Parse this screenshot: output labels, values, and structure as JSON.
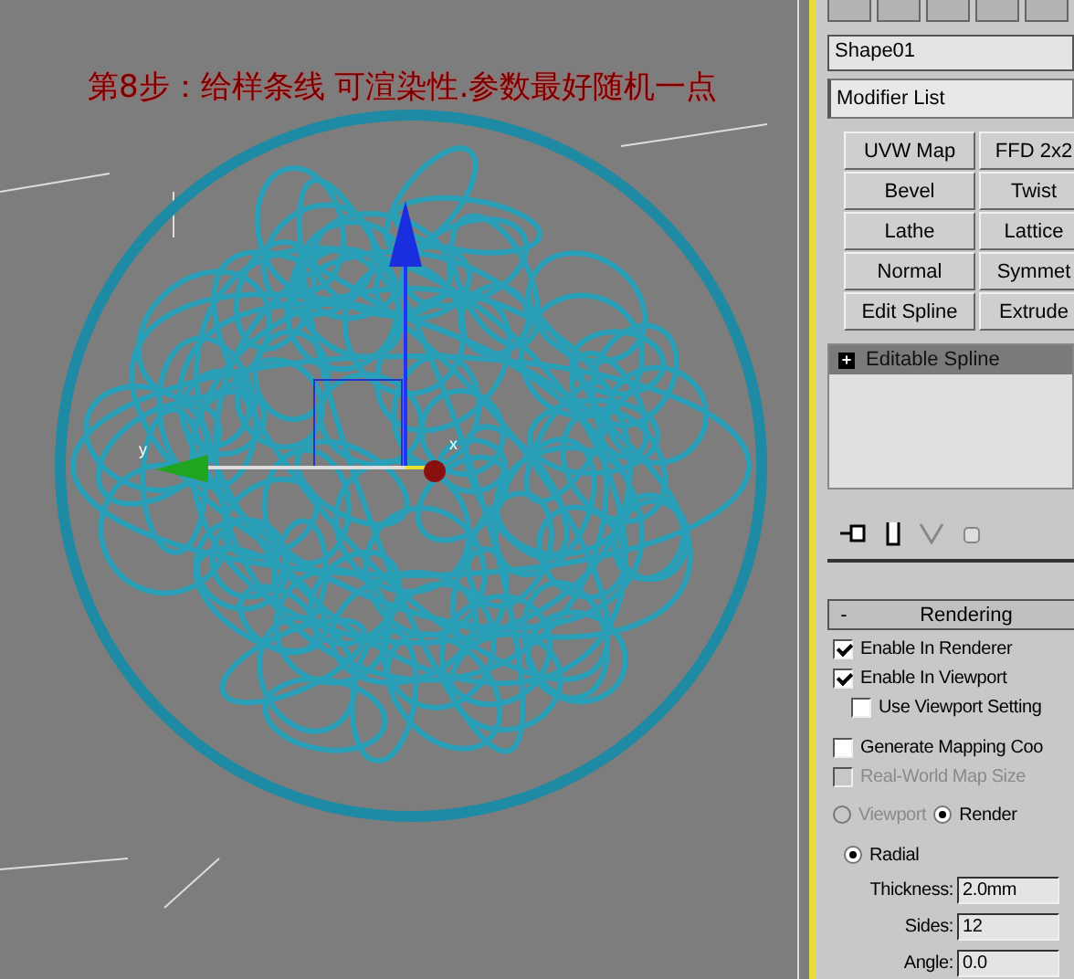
{
  "caption": "第8步：给样条线 可渲染性.参数最好随机一点",
  "viewport": {
    "axis_labels": [
      "y",
      "x"
    ]
  },
  "object_name": "Shape01",
  "modifier_list": "Modifier List",
  "modifier_buttons": [
    "UVW Map",
    "FFD 2x2",
    "Bevel",
    "Twist",
    "Lathe",
    "Lattice",
    "Normal",
    "Symmet",
    "Edit Spline",
    "Extrude"
  ],
  "stack": [
    {
      "label": "Editable Spline",
      "toggle": "+",
      "selected": true
    }
  ],
  "rollout": {
    "toggle": "-",
    "title": "Rendering"
  },
  "options": [
    {
      "label": "Enable In Renderer",
      "checked": true,
      "disabled": false
    },
    {
      "label": "Enable In Viewport",
      "checked": true,
      "disabled": false,
      "children": [
        {
          "label": "Use Viewport Setting",
          "checked": false,
          "disabled": false
        }
      ]
    },
    {
      "label": "Generate Mapping Coo",
      "checked": false,
      "disabled": false
    },
    {
      "label": "Real-World Map Size",
      "checked": false,
      "disabled": true
    }
  ],
  "mode_radios": [
    {
      "label": "Viewport",
      "selected": false,
      "disabled": true
    },
    {
      "label": "Render",
      "selected": true,
      "disabled": false
    }
  ],
  "shape_radios": [
    {
      "label": "Radial",
      "selected": true
    }
  ],
  "params": [
    {
      "label": "Thickness:",
      "value": "2.0mm"
    },
    {
      "label": "Sides:",
      "value": "12"
    },
    {
      "label": "Angle:",
      "value": "0.0"
    }
  ]
}
